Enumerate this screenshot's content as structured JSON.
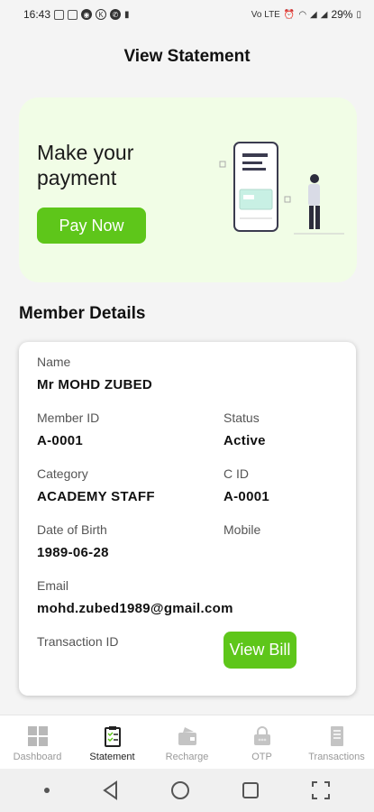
{
  "status_bar": {
    "time": "16:43",
    "battery": "29%"
  },
  "header": {
    "title": "View Statement"
  },
  "promo": {
    "text": "Make your payment",
    "button_label": "Pay Now"
  },
  "member_section": {
    "title": "Member Details"
  },
  "member": {
    "name_label": "Name",
    "name": "Mr MOHD ZUBED",
    "member_id_label": "Member ID",
    "member_id": "A-0001",
    "status_label": "Status",
    "status": "Active",
    "category_label": "Category",
    "category": "ACADEMY STAFF",
    "cid_label": "C ID",
    "cid": "A-0001",
    "dob_label": "Date of Birth",
    "dob": "1989-06-28",
    "mobile_label": "Mobile",
    "email_label": "Email",
    "email": "mohd.zubed1989@gmail.com",
    "transaction_id_label": "Transaction ID",
    "view_bill_label": "View Bill"
  },
  "bottom_nav": {
    "items": [
      {
        "label": "Dashboard",
        "icon": "dashboard-icon"
      },
      {
        "label": "Statement",
        "icon": "statement-icon",
        "active": true
      },
      {
        "label": "Recharge",
        "icon": "recharge-icon"
      },
      {
        "label": "OTP",
        "icon": "otp-icon"
      },
      {
        "label": "Transactions",
        "icon": "transactions-icon"
      }
    ]
  },
  "colors": {
    "accent": "#5ec61a",
    "promo_bg": "#f1fde6"
  }
}
